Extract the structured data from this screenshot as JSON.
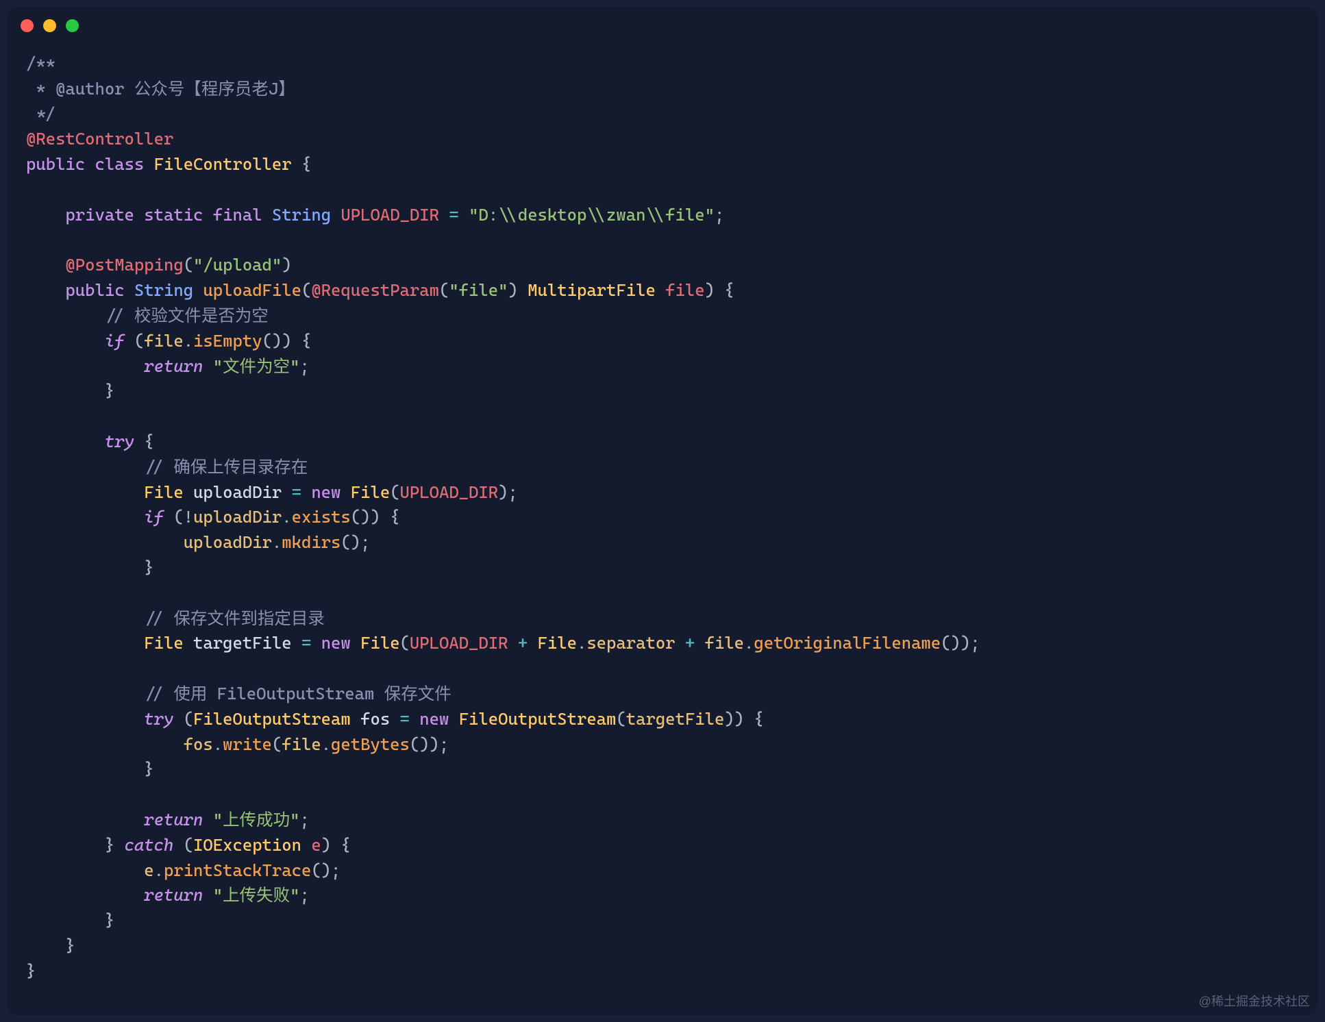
{
  "watermark": "@稀土掘金技术社区",
  "code": {
    "l1": "/**",
    "l2_prefix": " * @author ",
    "l2_text": "公众号【程序员老J】",
    "l3": " */",
    "l4_anno": "@RestController",
    "l5_public": "public",
    "l5_class": "class",
    "l5_name": "FileController",
    "l5_brace": " {",
    "l6_private": "private",
    "l6_static": "static",
    "l6_final": "final",
    "l6_type": "String",
    "l6_name": "UPLOAD_DIR",
    "l6_eq": " = ",
    "l6_str": "\"D:\\\\desktop\\\\zwan\\\\file\"",
    "l6_semi": ";",
    "l7_anno": "@PostMapping",
    "l7_lp": "(",
    "l7_str": "\"/upload\"",
    "l7_rp": ")",
    "l8_public": "public",
    "l8_type": "String",
    "l8_method": "uploadFile",
    "l8_lp": "(",
    "l8_anno": "@RequestParam",
    "l8_lp2": "(",
    "l8_str": "\"file\"",
    "l8_rp2": ")",
    "l8_ptype": "MultipartFile",
    "l8_pname": "file",
    "l8_rp": ")",
    "l8_brace": " {",
    "l9_comment": "// 校验文件是否为空",
    "l10_if": "if",
    "l10_lp": " (",
    "l10_var": "file",
    "l10_dot": ".",
    "l10_call": "isEmpty",
    "l10_paren": "()",
    "l10_rp": ") {",
    "l11_return": "return",
    "l11_str": "\"文件为空\"",
    "l11_semi": ";",
    "l12_brace": "}",
    "l13_try": "try",
    "l13_brace": " {",
    "l14_comment": "// 确保上传目录存在",
    "l15_type": "File",
    "l15_var": "uploadDir",
    "l15_eq": " = ",
    "l15_new": "new",
    "l15_ctor": "File",
    "l15_lp": "(",
    "l15_arg": "UPLOAD_DIR",
    "l15_rp": ");",
    "l16_if": "if",
    "l16_lp": " (!",
    "l16_var": "uploadDir",
    "l16_dot": ".",
    "l16_call": "exists",
    "l16_paren": "()",
    "l16_rp": ") {",
    "l17_var": "uploadDir",
    "l17_dot": ".",
    "l17_call": "mkdirs",
    "l17_paren": "();",
    "l18_brace": "}",
    "l19_comment": "// 保存文件到指定目录",
    "l20_type": "File",
    "l20_var": "targetFile",
    "l20_eq": " = ",
    "l20_new": "new",
    "l20_ctor": "File",
    "l20_lp": "(",
    "l20_arg1": "UPLOAD_DIR",
    "l20_plus": " + ",
    "l20_cls": "File",
    "l20_dot": ".",
    "l20_sep": "separator",
    "l20_plus2": " + ",
    "l20_var2": "file",
    "l20_dot2": ".",
    "l20_call": "getOriginalFilename",
    "l20_rp": "());",
    "l21_comment": "// 使用 FileOutputStream 保存文件",
    "l22_try": "try",
    "l22_lp": " (",
    "l22_type": "FileOutputStream",
    "l22_var": "fos",
    "l22_eq": " = ",
    "l22_new": "new",
    "l22_ctor": "FileOutputStream",
    "l22_lp2": "(",
    "l22_arg": "targetFile",
    "l22_rp": ")) {",
    "l23_var": "fos",
    "l23_dot": ".",
    "l23_call": "write",
    "l23_lp": "(",
    "l23_var2": "file",
    "l23_dot2": ".",
    "l23_call2": "getBytes",
    "l23_rp": "());",
    "l24_brace": "}",
    "l25_return": "return",
    "l25_str": "\"上传成功\"",
    "l25_semi": ";",
    "l26_brace": "}",
    "l26_catch": "catch",
    "l26_lp": " (",
    "l26_type": "IOException",
    "l26_var": "e",
    "l26_rp": ") {",
    "l27_var": "e",
    "l27_dot": ".",
    "l27_call": "printStackTrace",
    "l27_rp": "();",
    "l28_return": "return",
    "l28_str": "\"上传失败\"",
    "l28_semi": ";",
    "l29_brace": "}",
    "l30_brace": "}",
    "l31_brace": "}"
  }
}
